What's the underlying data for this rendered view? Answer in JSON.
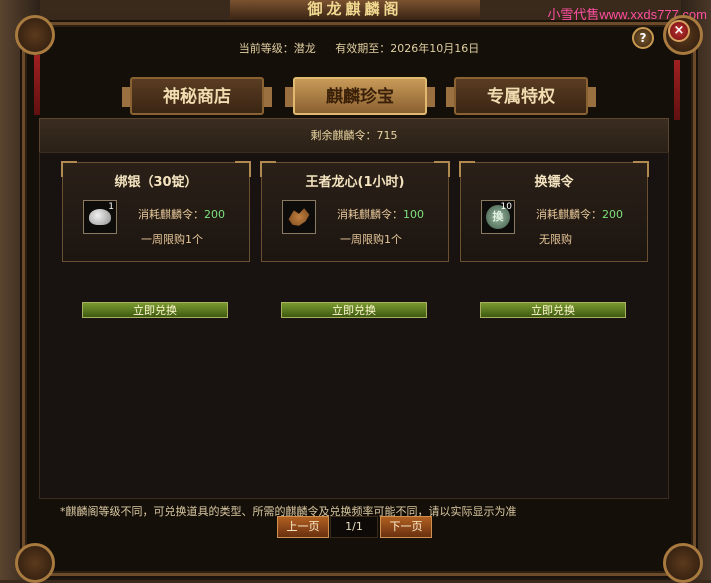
{
  "window": {
    "title": "御龙麒麟阁",
    "watermark": "小雪代售www.xxds777.com",
    "help_label": "?",
    "close_label": "×"
  },
  "info": {
    "level": "当前等级：潜龙",
    "expiry": "有效期至：2026年10月16日"
  },
  "tabs": [
    {
      "label": "神秘商店",
      "active": false
    },
    {
      "label": "麒麟珍宝",
      "active": true
    },
    {
      "label": "专属特权",
      "active": false
    }
  ],
  "remaining": "剩余麒麟令：715",
  "items": [
    {
      "title": "绑银（30锭）",
      "icon": "silver-ingot-icon",
      "qty": "1",
      "cost_label": "消耗麒麟令：",
      "cost": "200",
      "limit": "一周限购1个",
      "button": "立即兑换"
    },
    {
      "title": "王者龙心(1小时)",
      "icon": "dragon-heart-icon",
      "qty": "",
      "cost_label": "消耗麒麟令：",
      "cost": "100",
      "limit": "一周限购1个",
      "button": "立即兑换"
    },
    {
      "title": "换镖令",
      "icon": "escort-token-icon",
      "qty": "10",
      "icon_text": "換",
      "cost_label": "消耗麒麟令：",
      "cost": "200",
      "limit": "无限购",
      "button": "立即兑换"
    }
  ],
  "note": "*麒麟阁等级不同，可兑换道具的类型、所需的麒麟令及兑换频率可能不同，请以实际显示为准",
  "pager": {
    "prev": "上一页",
    "page": "1/1",
    "next": "下一页"
  }
}
